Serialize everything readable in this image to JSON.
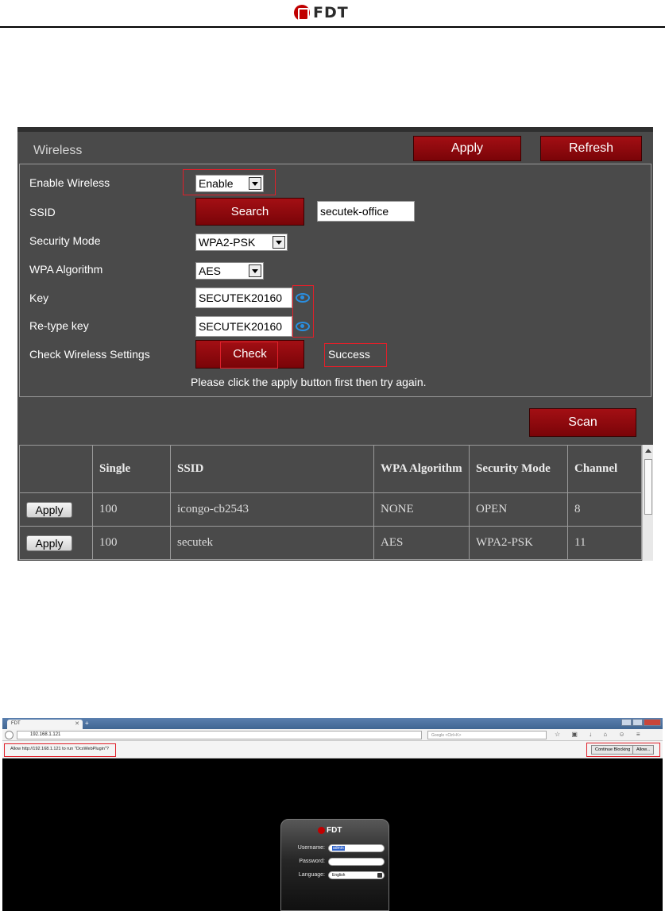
{
  "header": {
    "logo_text": "FDT",
    "brand_color": "#c00000"
  },
  "wireless": {
    "title": "Wireless",
    "apply_label": "Apply",
    "refresh_label": "Refresh",
    "fields": {
      "enable_wireless": {
        "label": "Enable Wireless",
        "value": "Enable"
      },
      "ssid": {
        "label": "SSID",
        "search_label": "Search",
        "value": "secutek-office"
      },
      "security_mode": {
        "label": "Security Mode",
        "value": "WPA2-PSK"
      },
      "wpa_algorithm": {
        "label": "WPA Algorithm",
        "value": "AES"
      },
      "key": {
        "label": "Key",
        "value": "SECUTEK20160"
      },
      "retype_key": {
        "label": "Re-type key",
        "value": "SECUTEK20160"
      },
      "check": {
        "label": "Check Wireless Settings",
        "button_label": "Check",
        "result": "Success"
      }
    },
    "note": "Please click the apply button first then try again.",
    "scan_label": "Scan",
    "table": {
      "headers": [
        "",
        "Single",
        "SSID",
        "WPA Algorithm",
        "Security Mode",
        "Channel"
      ],
      "rows": [
        {
          "action": "Apply",
          "single": "100",
          "ssid": "icongo-cb2543",
          "wpa": "NONE",
          "security": "OPEN",
          "channel": "8"
        },
        {
          "action": "Apply",
          "single": "100",
          "ssid": "secutek",
          "wpa": "AES",
          "security": "WPA2-PSK",
          "channel": "11"
        }
      ]
    },
    "accent_red": "#8b0a0f",
    "highlight_color": "#e0202a"
  },
  "browser": {
    "tab_title": "FDT",
    "url": "192.168.1.121",
    "search_placeholder": "Google <Ctrl+K>",
    "notification": "Allow http://192.168.1.121 to run \"OcxWebPlugin\"?",
    "continue_blocking_label": "Continue Blocking",
    "allow_label": "Allow...",
    "login": {
      "logo_text": "FDT",
      "username_label": "Username:",
      "username_value": "admin",
      "password_label": "Password:",
      "language_label": "Language:",
      "language_value": "English"
    }
  }
}
